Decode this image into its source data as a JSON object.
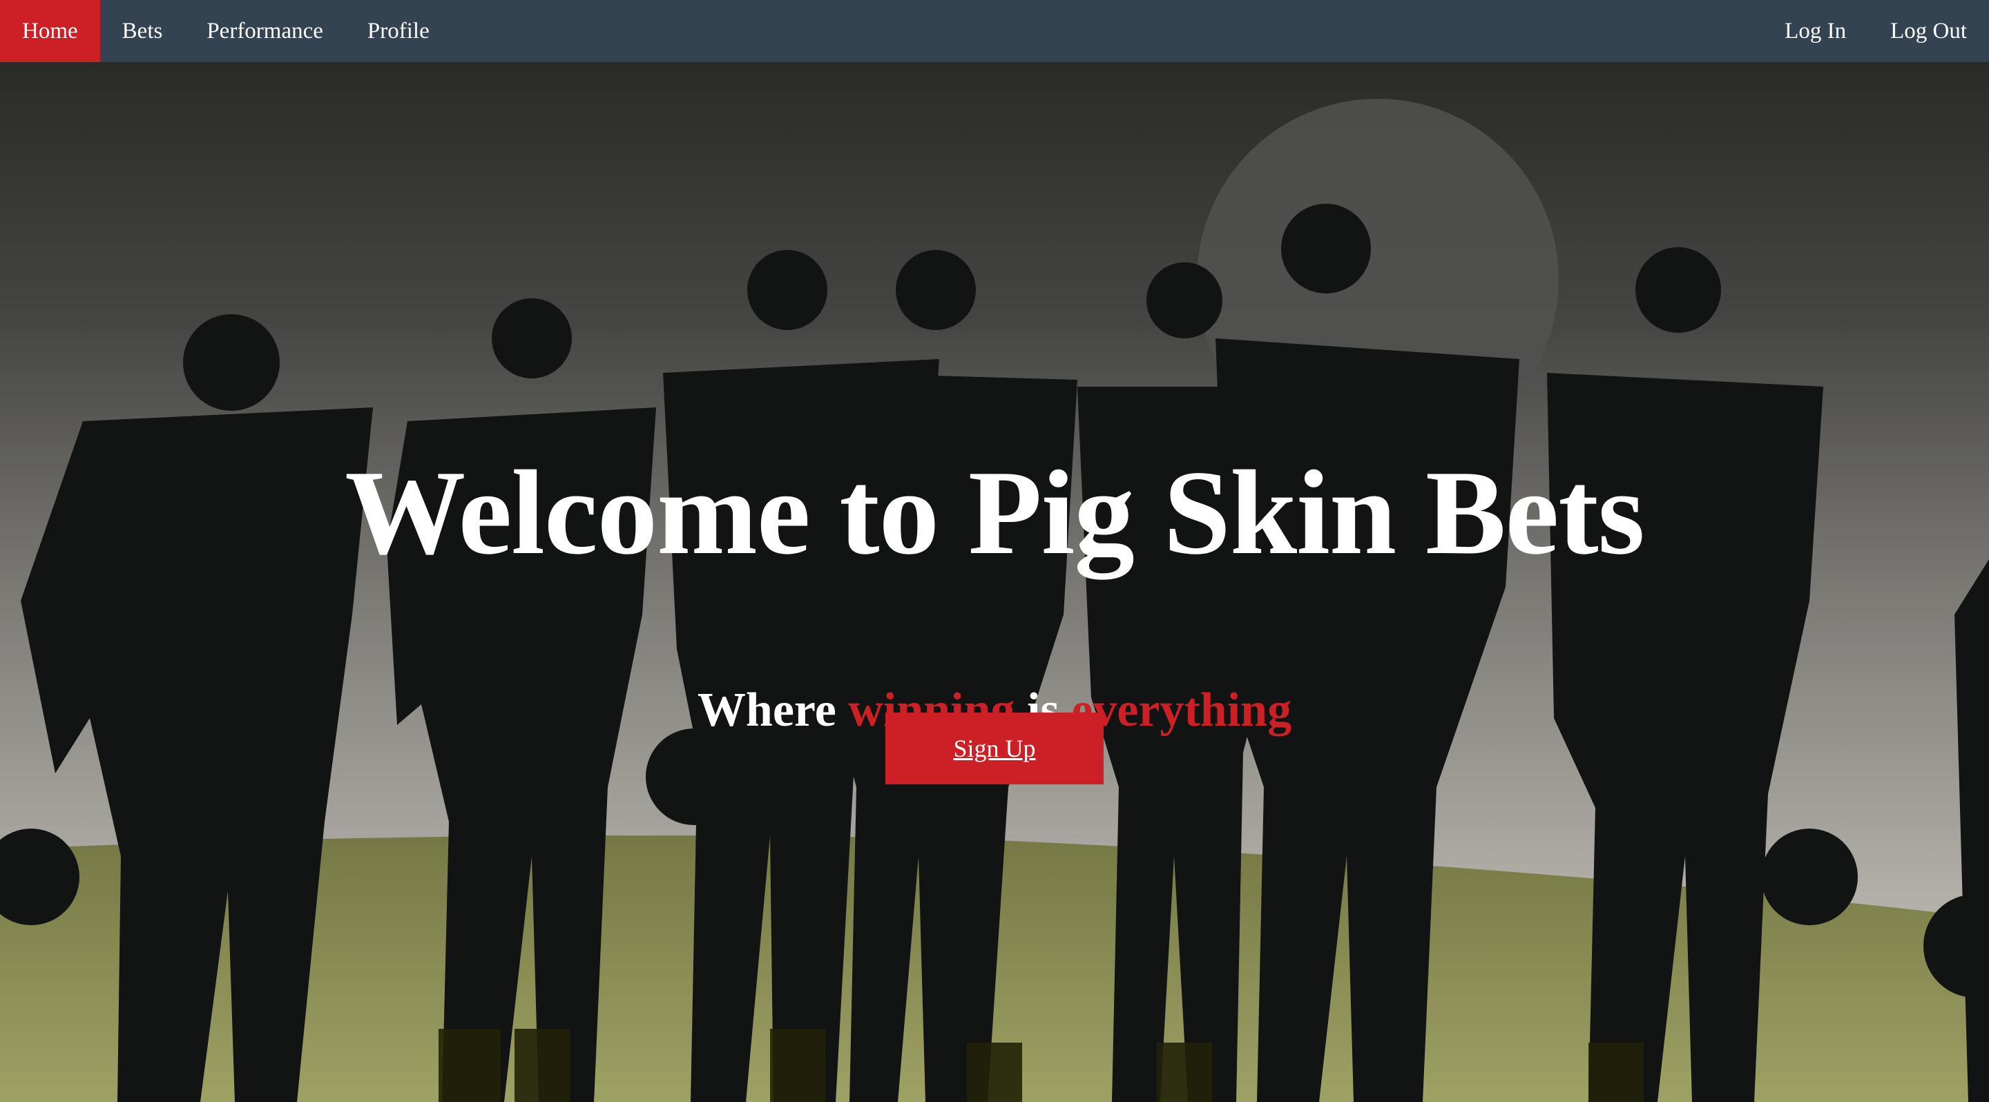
{
  "nav": {
    "home": "Home",
    "bets": "Bets",
    "performance": "Performance",
    "profile": "Profile",
    "login": "Log In",
    "logout": "Log Out"
  },
  "hero": {
    "title": "Welcome to Pig Skin Bets",
    "subtitle": {
      "part1": "Where ",
      "part2": "winning",
      "part3": " is ",
      "part4": "everything"
    },
    "signup": "Sign Up"
  },
  "colors": {
    "nav_bg": "#344351",
    "accent": "#cc2026",
    "text": "#ffffff"
  }
}
